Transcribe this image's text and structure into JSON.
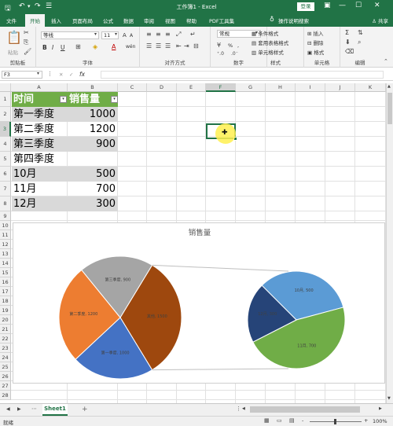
{
  "window": {
    "title": "工作簿1 - Excel",
    "login": "登录"
  },
  "quick_access": {
    "save_icon": "save-icon",
    "undo_icon": "undo-icon",
    "redo_icon": "redo-icon"
  },
  "ribbon_tabs": [
    "文件",
    "开始",
    "插入",
    "页面布局",
    "公式",
    "数据",
    "审阅",
    "视图",
    "帮助",
    "PDF工具集",
    "操作说明搜索"
  ],
  "share": "共享",
  "ribbon": {
    "clipboard": {
      "label": "剪贴板",
      "paste": "粘贴"
    },
    "font": {
      "label": "字体",
      "name": "等线",
      "size": "11",
      "bold": "B",
      "italic": "I",
      "underline": "U",
      "grow": "A",
      "shrink": "A",
      "wen": "wén"
    },
    "alignment": {
      "label": "对齐方式"
    },
    "number": {
      "label": "数字",
      "format": "常规",
      "percent": "%",
      "comma": ","
    },
    "styles": {
      "label": "样式",
      "conditional": "条件格式",
      "table": "套用表格格式",
      "cell": "单元格样式"
    },
    "cells": {
      "label": "单元格",
      "insert": "插入",
      "delete": "删除",
      "format": "格式"
    },
    "editing": {
      "label": "编辑",
      "sigma": "Σ"
    }
  },
  "formula_bar": {
    "name_box": "F3",
    "cancel": "✕",
    "enter": "✓",
    "fx": "fx",
    "formula": ""
  },
  "columns": [
    "A",
    "B",
    "C",
    "D",
    "E",
    "F",
    "G",
    "H",
    "I",
    "J",
    "K"
  ],
  "rows": [
    "1",
    "2",
    "3",
    "4",
    "5",
    "6",
    "7",
    "8",
    "9",
    "10",
    "11",
    "12",
    "13",
    "14",
    "15",
    "16",
    "17",
    "18",
    "19",
    "20",
    "21",
    "22",
    "23",
    "24",
    "25",
    "26",
    "27",
    "28"
  ],
  "table": {
    "headers": [
      "时间",
      "销售量"
    ],
    "rows": [
      [
        "第一季度",
        "1000"
      ],
      [
        "第二季度",
        "1200"
      ],
      [
        "第三季度",
        "900"
      ],
      [
        "第四季度",
        ""
      ],
      [
        "10月",
        "500"
      ],
      [
        "11月",
        "700"
      ],
      [
        "12月",
        "300"
      ]
    ]
  },
  "selected_cell": "F3",
  "chart_data": {
    "type": "pie",
    "title": "销售量",
    "main_pie": [
      {
        "label": "第一季度",
        "value": 1000,
        "data_label": "第一季度, 1000",
        "color": "#4472c4"
      },
      {
        "label": "第二季度",
        "value": 1200,
        "data_label": "第二季度, 1200",
        "color": "#ed7d31"
      },
      {
        "label": "第三季度",
        "value": 900,
        "data_label": "第三季度, 900",
        "color": "#a5a5a5"
      },
      {
        "label": "其他",
        "value": 1500,
        "data_label": "其他, 1500",
        "color": "#9e480e"
      }
    ],
    "secondary_pie": [
      {
        "label": "10月",
        "value": 500,
        "data_label": "10月, 500",
        "color": "#5b9bd5"
      },
      {
        "label": "11月",
        "value": 700,
        "data_label": "11月, 700",
        "color": "#70ad47"
      },
      {
        "label": "12月",
        "value": 300,
        "data_label": "12月, 300",
        "color": "#264478"
      }
    ]
  },
  "sheet": {
    "tab": "Sheet1",
    "add": "+"
  },
  "status": {
    "ready": "就绪",
    "zoom": "100%",
    "minus": "-",
    "plus": "+"
  },
  "colors": {
    "excel_green": "#217346",
    "header_fill": "#70ad47",
    "band_fill": "#d9d9d9"
  }
}
